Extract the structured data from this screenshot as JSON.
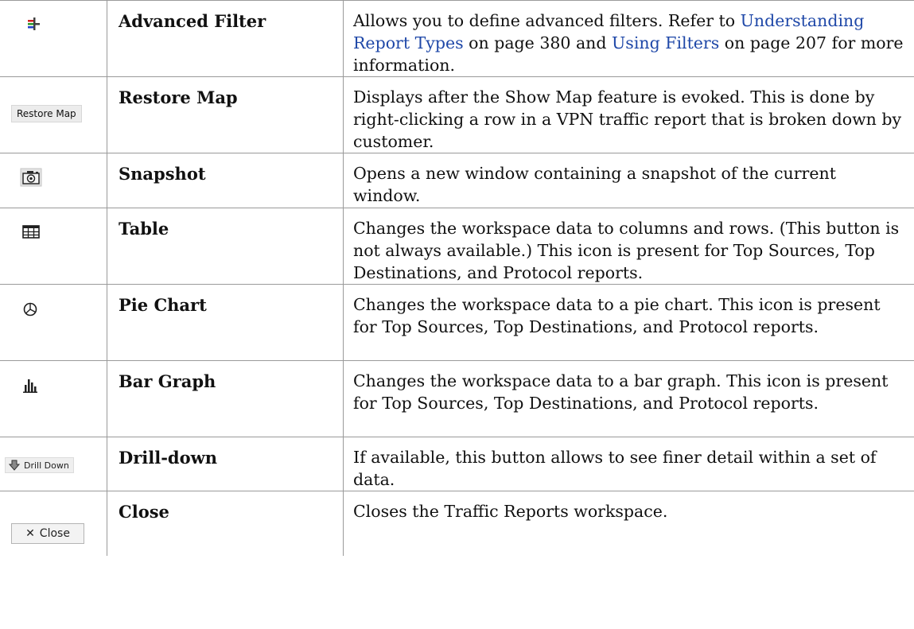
{
  "rows": [
    {
      "icon": "advanced-filter-icon",
      "name": "Advanced Filter",
      "desc_parts": [
        {
          "text": "Allows you to define advanced filters. Refer to "
        },
        {
          "text": "Understanding Report Types",
          "link": true
        },
        {
          "text": " on page 380 and "
        },
        {
          "text": "Using Filters",
          "link": true
        },
        {
          "text": " on page 207 for more information."
        }
      ]
    },
    {
      "icon": "restore-map-button",
      "icon_label": "Restore Map",
      "name": "Restore Map",
      "description": "Displays after the Show Map feature is evoked. This is done by right-clicking a row in a VPN traffic report that is broken down by customer."
    },
    {
      "icon": "camera-icon",
      "name": "Snapshot",
      "description": "Opens a new window containing a snapshot of the current window."
    },
    {
      "icon": "table-grid-icon",
      "name": "Table",
      "description": "Changes the workspace data to columns and rows. (This button is not always available.) This icon is present for Top Sources, Top Destinations, and Protocol reports."
    },
    {
      "icon": "pie-chart-icon",
      "name": "Pie Chart",
      "description": "Changes the workspace data to a pie chart. This icon is present for Top Sources, Top Destinations, and Protocol reports."
    },
    {
      "icon": "bar-graph-icon",
      "name": "Bar Graph",
      "description": "Changes the workspace data to a bar graph. This icon is present for Top Sources, Top Destinations, and Protocol reports."
    },
    {
      "icon": "drill-down-button",
      "icon_label": "Drill Down",
      "name": "Drill-down",
      "description": "If available, this button allows to see finer detail within a set of data."
    },
    {
      "icon": "close-button",
      "icon_label": "Close",
      "name": "Close",
      "description": "Closes the Traffic Reports workspace."
    }
  ]
}
